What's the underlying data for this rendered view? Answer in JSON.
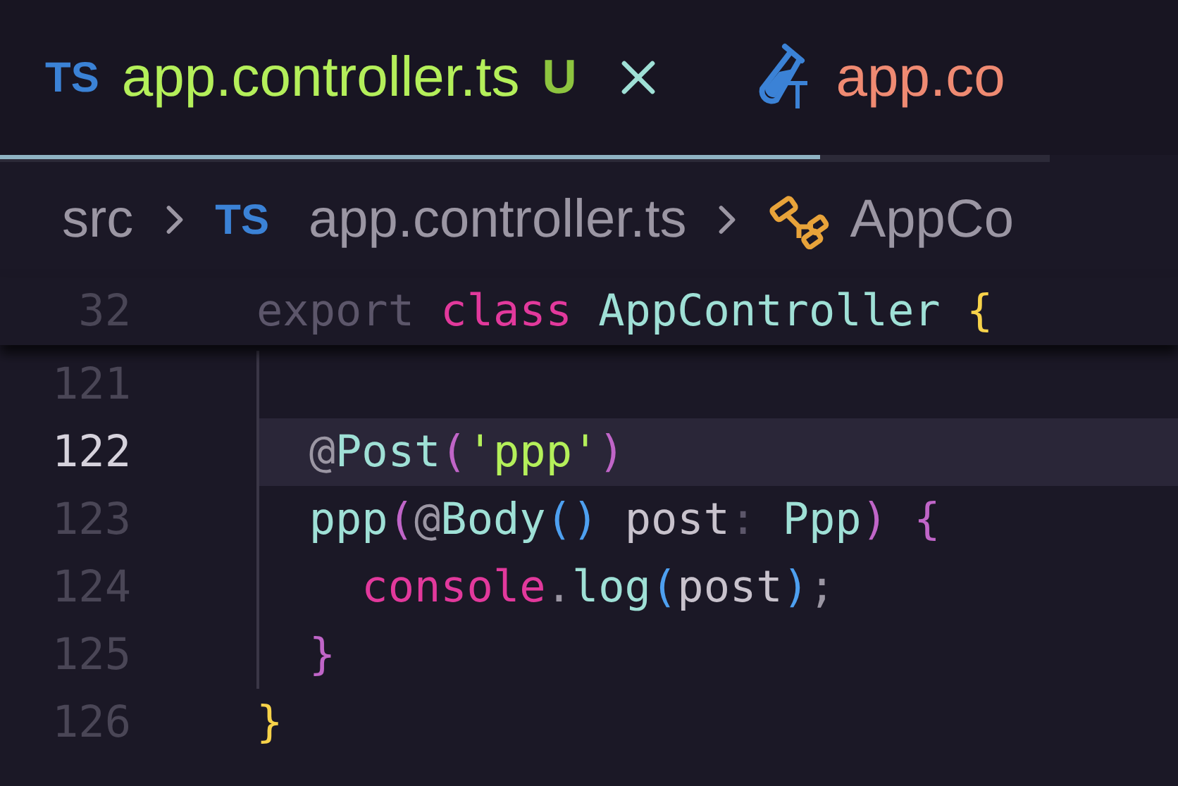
{
  "tabs": [
    {
      "icon": "TS",
      "kind": "typescript",
      "label": "app.controller.ts",
      "status": "U",
      "color": "#b4ef5a",
      "closable": true
    },
    {
      "kind": "test",
      "label": "app.co",
      "color": "#ef8a72",
      "closable": false
    }
  ],
  "breadcrumbs": [
    {
      "kind": "folder",
      "label": "src"
    },
    {
      "kind": "file",
      "icon": "TS",
      "label": "app.controller.ts"
    },
    {
      "kind": "symbol",
      "label": "AppCo"
    }
  ],
  "sticky_line": {
    "number": "32",
    "tokens": [
      {
        "text": "export ",
        "kind": "muted"
      },
      {
        "text": "class ",
        "kind": "keyword"
      },
      {
        "text": "AppController ",
        "kind": "type"
      },
      {
        "text": "{",
        "kind": "brace"
      }
    ]
  },
  "lines": [
    {
      "number": "121",
      "current": false,
      "guide": true
    },
    {
      "number": "122",
      "current": true,
      "guide": true,
      "tokens": [
        {
          "text": "  @",
          "kind": "punct"
        },
        {
          "text": "Post",
          "kind": "type"
        },
        {
          "text": "(",
          "kind": "paren"
        },
        {
          "text": "'ppp'",
          "kind": "string"
        },
        {
          "text": ")",
          "kind": "paren"
        }
      ]
    },
    {
      "number": "123",
      "current": false,
      "guide": true,
      "tokens": [
        {
          "text": "  ppp",
          "kind": "type"
        },
        {
          "text": "(",
          "kind": "paren"
        },
        {
          "text": "@",
          "kind": "punct"
        },
        {
          "text": "Body",
          "kind": "type"
        },
        {
          "text": "()",
          "kind": "paren2"
        },
        {
          "text": " post",
          "kind": "variable"
        },
        {
          "text": ": ",
          "kind": "muted"
        },
        {
          "text": "Ppp",
          "kind": "type"
        },
        {
          "text": ") {",
          "kind": "paren"
        }
      ]
    },
    {
      "number": "124",
      "current": false,
      "guide": true,
      "tokens": [
        {
          "text": "    console",
          "kind": "keyword"
        },
        {
          "text": ".",
          "kind": "punct"
        },
        {
          "text": "log",
          "kind": "type"
        },
        {
          "text": "(",
          "kind": "paren2"
        },
        {
          "text": "post",
          "kind": "variable"
        },
        {
          "text": ")",
          "kind": "paren2"
        },
        {
          "text": ";",
          "kind": "punct"
        }
      ]
    },
    {
      "number": "125",
      "current": false,
      "guide": true,
      "tokens": [
        {
          "text": "  }",
          "kind": "paren"
        }
      ]
    },
    {
      "number": "126",
      "current": false,
      "guide": false,
      "tokens": [
        {
          "text": "}",
          "kind": "brace"
        }
      ]
    }
  ]
}
